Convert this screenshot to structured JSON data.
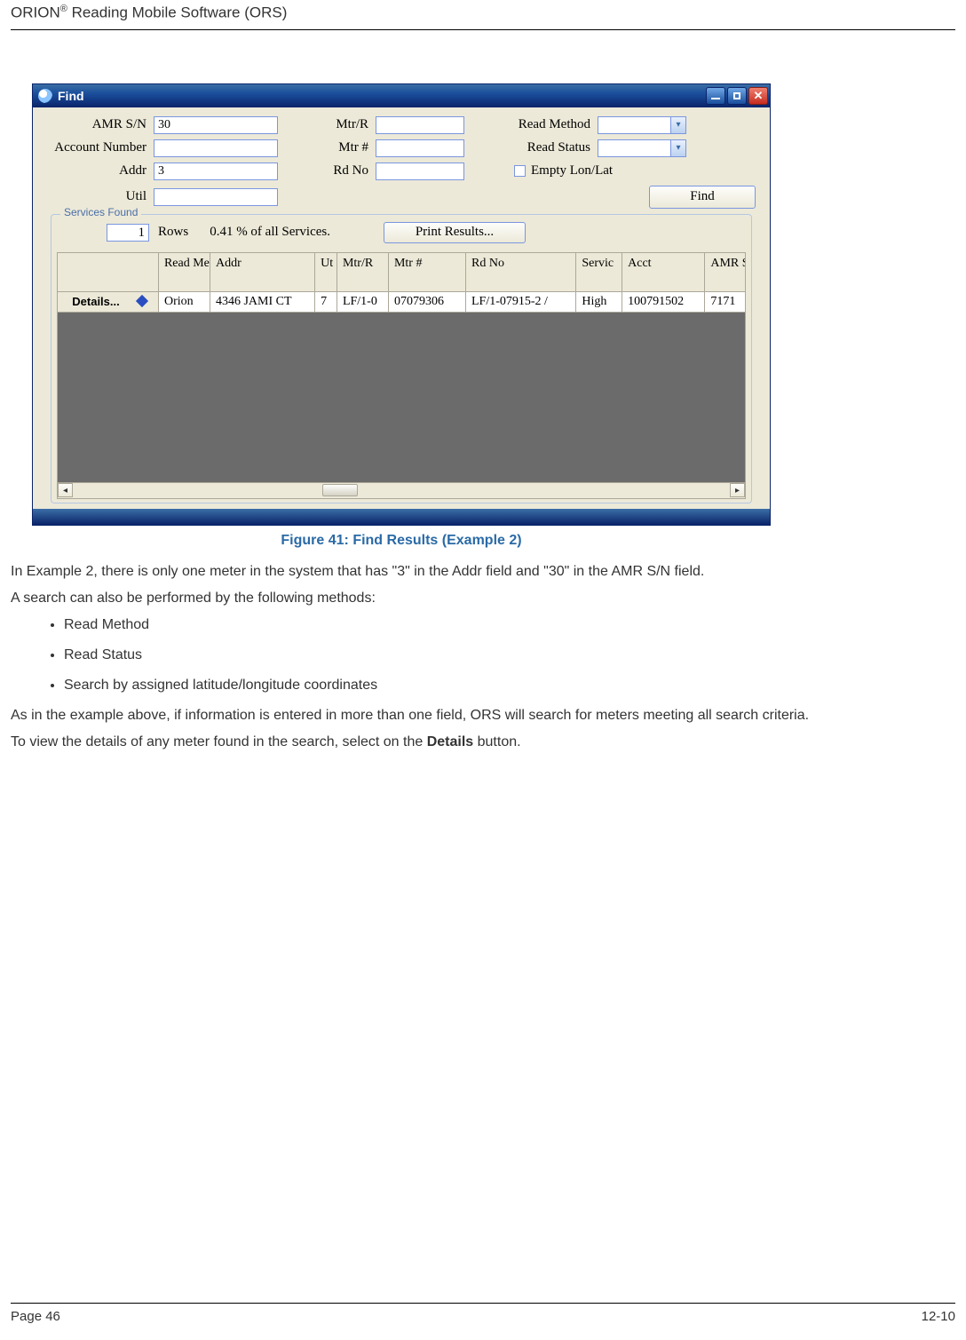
{
  "header": {
    "title_prefix": "ORION",
    "reg": "®",
    "title_suffix": " Reading Mobile Software (ORS)"
  },
  "window": {
    "title": "Find",
    "labels": {
      "amr_sn": "AMR S/N",
      "account_number": "Account Number",
      "addr": "Addr",
      "util": "Util",
      "mtr_r": "Mtr/R",
      "mtr_num": "Mtr #",
      "rd_no": "Rd No",
      "read_method": "Read Method",
      "read_status": "Read Status",
      "empty_lonlat": "Empty Lon/Lat",
      "find_btn": "Find"
    },
    "values": {
      "amr_sn": "30",
      "addr": "3"
    },
    "services": {
      "legend": "Services Found",
      "count": "1",
      "rows_label": "Rows",
      "pct": "0.41 % of all Services.",
      "print_btn": "Print Results..."
    },
    "grid": {
      "headers": {
        "read_method": "Read Method",
        "addr": "Addr",
        "ut": "Ut",
        "mtr_r": "Mtr/R",
        "mtr_num": "Mtr #",
        "rd_no": "Rd No",
        "servic": "Servic",
        "acct": "Acct",
        "amr_sn": "AMR S/N"
      },
      "details_btn": "Details...",
      "row": {
        "read_method": "Orion",
        "addr": "4346 JAMI CT",
        "ut": "7",
        "mtr_r": "LF/1-0",
        "mtr_num": "07079306",
        "rd_no": "LF/1-07915-2 /",
        "servic": "High",
        "acct": "100791502",
        "amr_sn": "7171"
      }
    }
  },
  "caption": "Figure 41:  Find Results (Example 2)",
  "body": {
    "p1": "In Example 2, there is only one meter in the system that has \"3\" in the Addr field and \"30\" in the AMR S/N field.",
    "p2": " A search can also be performed by the following methods:",
    "li1": "Read Method",
    "li2": "Read Status",
    "li3": "Search by assigned latitude/longitude coordinates",
    "p3": "As in the example above, if information is entered in more than one field, ORS will search for meters meeting all search criteria.",
    "p4_a": "To view the details of any meter found in the search, select on the ",
    "p4_b": "Details",
    "p4_c": " button."
  },
  "footer": {
    "left": "Page 46",
    "right": "12-10"
  }
}
